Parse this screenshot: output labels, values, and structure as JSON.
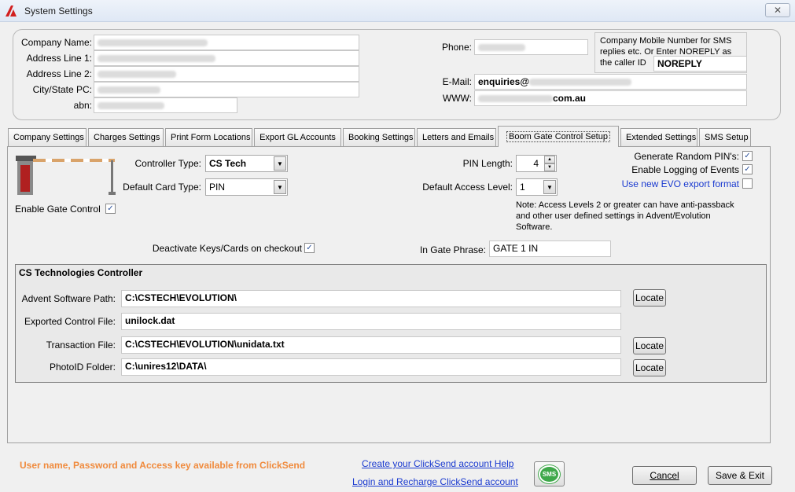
{
  "window": {
    "title": "System Settings",
    "close": "✕"
  },
  "company": {
    "labels": {
      "name": "Company Name:",
      "addr1": "Address Line 1:",
      "addr2": "Address Line 2:",
      "city": "City/State PC:",
      "abn": "abn:",
      "phone": "Phone:",
      "email": "E-Mail:",
      "www": "WWW:"
    },
    "email_value": "enquiries@",
    "www_suffix": "com.au",
    "sms_note": "Company Mobile Number for SMS replies etc. Or Enter NOREPLY as the caller ID",
    "sms_value": "NOREPLY"
  },
  "tabs": [
    "Company Settings",
    "Charges Settings",
    "Print Form Locations",
    "Export GL Accounts",
    "Booking Settings",
    "Letters and Emails",
    "Boom Gate Control Setup",
    "Extended Settings",
    "SMS Setup"
  ],
  "gate": {
    "controller_type_label": "Controller Type:",
    "controller_type": "CS Tech",
    "card_type_label": "Default Card Type:",
    "card_type": "PIN",
    "enable_label": "Enable Gate Control",
    "pin_length_label": "PIN Length:",
    "pin_length": "4",
    "access_level_label": "Default Access Level:",
    "access_level": "1",
    "gen_pins_label": "Generate Random PIN's:",
    "logging_label": "Enable Logging of Events",
    "evo_label": "Use new EVO export format",
    "access_note": "Note: Access Levels 2 or greater can have anti-passback and other user defined settings in Advent/Evolution Software.",
    "deactivate_label": "Deactivate Keys/Cards on checkout",
    "in_gate_label": "In Gate Phrase:",
    "in_gate_value": "GATE 1 IN",
    "check": "✓"
  },
  "cs": {
    "title": "CS Technologies Controller",
    "advent_label": "Advent Software Path:",
    "advent_value": "C:\\CSTECH\\EVOLUTION\\",
    "exported_label": "Exported Control File:",
    "exported_value": "unilock.dat",
    "trans_label": "Transaction File:",
    "trans_value": "C:\\CSTECH\\EVOLUTION\\unidata.txt",
    "photo_label": "PhotoID Folder:",
    "photo_value": "C:\\unires12\\DATA\\",
    "locate": "Locate"
  },
  "footer": {
    "clicksend_note": "User name, Password and Access key available from ClickSend",
    "create_link": "Create your ClickSend account Help",
    "login_link": "Login and Recharge ClickSend account",
    "sms_icon_text": "SMS",
    "cancel": "Cancel",
    "save_exit": "Save & Exit"
  },
  "colors": {
    "note_orange": "#f08a3c",
    "link_blue": "#1a3ad0",
    "sms_green": "#3fa84a"
  }
}
